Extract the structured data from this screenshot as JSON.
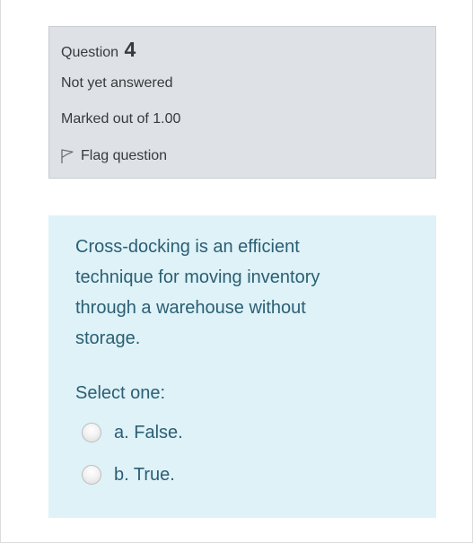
{
  "question_info": {
    "title_prefix": "Question",
    "number": "4",
    "state": "Not yet answered",
    "grade": "Marked out of 1.00",
    "flag_label": "Flag question"
  },
  "question": {
    "text": "Cross-docking is an efficient technique for moving inventory through a warehouse without storage.",
    "prompt": "Select one:",
    "answers": [
      {
        "label": "a. False.",
        "selected": false
      },
      {
        "label": "b. True.",
        "selected": false
      }
    ]
  },
  "colors": {
    "info_background": "#dee2e6",
    "content_background": "#def2f8",
    "content_text": "#2b5f73",
    "info_text": "#373a3c"
  },
  "icons": {
    "flag": "flag-icon",
    "radio": "radio-button-icon"
  }
}
